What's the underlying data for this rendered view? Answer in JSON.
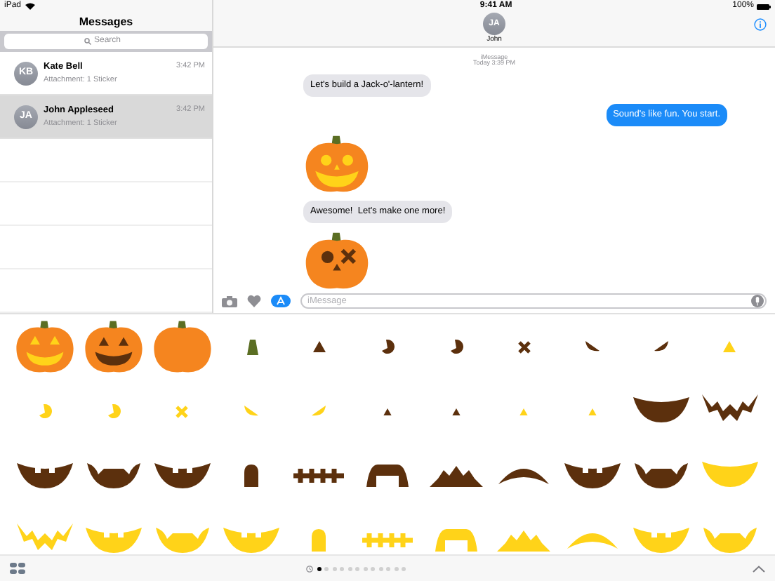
{
  "status_bar": {
    "device": "iPad",
    "time": "9:41 AM",
    "battery": "100%"
  },
  "sidebar": {
    "title": "Messages",
    "search": {
      "placeholder": "Search"
    },
    "conversations": [
      {
        "initials": "KB",
        "name": "Kate Bell",
        "time": "3:42 PM",
        "preview": "Attachment: 1 Sticker",
        "selected": false
      },
      {
        "initials": "JA",
        "name": "John Appleseed",
        "time": "3:42 PM",
        "preview": "Attachment: 1 Sticker",
        "selected": true
      }
    ]
  },
  "chat": {
    "initials": "JA",
    "name": "John",
    "service": "iMessage",
    "timestamp": "Today 3:39 PM",
    "messages": [
      {
        "kind": "text",
        "outgoing": false,
        "text": "Let's build a Jack-o'-lantern!"
      },
      {
        "kind": "text",
        "outgoing": true,
        "text": "Sound's like fun. You start."
      },
      {
        "kind": "grin"
      },
      {
        "kind": "text",
        "outgoing": false,
        "text": "Awesome!  Let's make one more!"
      },
      {
        "kind": "dazed"
      }
    ],
    "input": {
      "placeholder": "iMessage"
    }
  },
  "sticker_drawer": {
    "page_dots": [
      {
        "selected": true
      },
      {
        "selected": false
      },
      {
        "selected": false
      },
      {
        "selected": false
      },
      {
        "selected": false
      },
      {
        "selected": false
      },
      {
        "selected": false
      },
      {
        "selected": false
      },
      {
        "selected": false
      },
      {
        "selected": false
      },
      {
        "selected": false
      },
      {
        "selected": false
      }
    ]
  }
}
